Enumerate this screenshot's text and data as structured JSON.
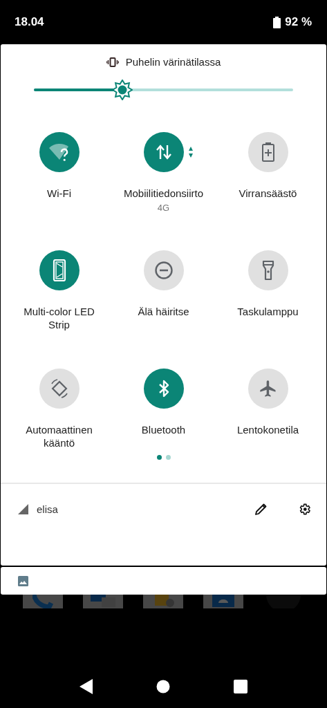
{
  "status_bar": {
    "time": "18.04",
    "battery": "92 %"
  },
  "quick_settings": {
    "ringer": {
      "label": "Puhelin värinätilassa"
    },
    "brightness": {
      "level": 0.34
    },
    "tiles": [
      {
        "kind": "wifi",
        "label": "Wi-Fi",
        "on": true
      },
      {
        "kind": "mobile-data",
        "label": "Mobiilitiedonsiirto",
        "sublabel": "4G",
        "on": true
      },
      {
        "kind": "battery-saver",
        "label": "Virransäästö",
        "on": false
      },
      {
        "kind": "led-strip",
        "label": "Multi-color LED Strip",
        "on": true
      },
      {
        "kind": "do-not-disturb",
        "label": "Älä häiritse",
        "on": false
      },
      {
        "kind": "flashlight",
        "label": "Taskulamppu",
        "on": false
      },
      {
        "kind": "auto-rotate",
        "label": "Automaattinen kääntö",
        "on": false
      },
      {
        "kind": "bluetooth",
        "label": "Bluetooth",
        "on": true
      },
      {
        "kind": "airplane",
        "label": "Lentokonetila",
        "on": false
      }
    ],
    "pages": [
      {
        "selected": true
      },
      {
        "selected": false
      }
    ],
    "footer": {
      "carrier": "elisa"
    }
  }
}
